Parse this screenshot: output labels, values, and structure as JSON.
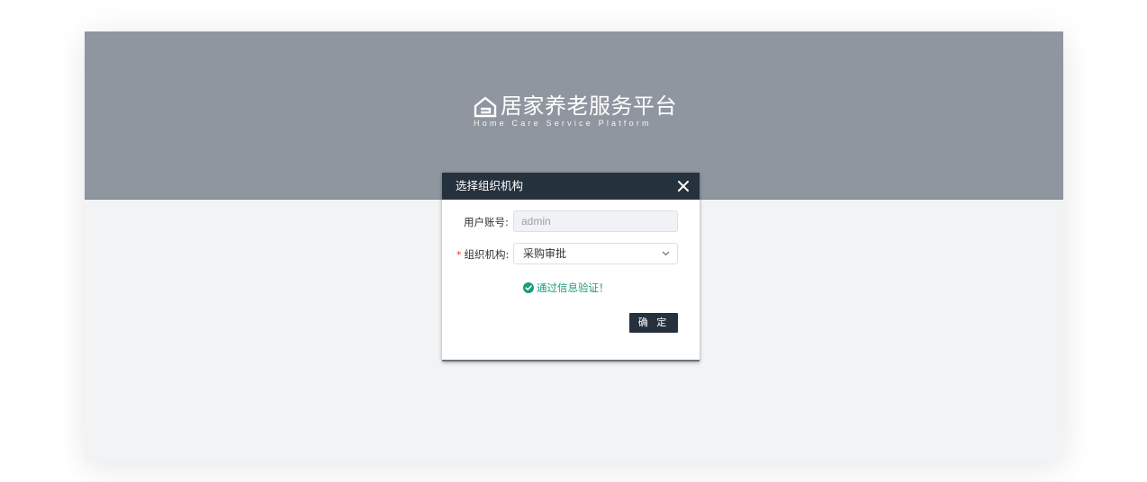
{
  "banner": {
    "logo_title": "居家养老服务平台",
    "logo_subtitle": "Home Care Service Platform",
    "logo_icon": "house-g-icon"
  },
  "dialog": {
    "title": "选择组织机构",
    "close_icon": "close-icon",
    "account_label": "用户账号:",
    "account_placeholder": "admin",
    "org_required_mark": "*",
    "org_label": "组织机构:",
    "org_value": "采购审批",
    "verify_message": "通过信息验证！",
    "confirm_label": "确 定"
  },
  "colors": {
    "banner_bg": "#8f969f",
    "dialog_header_bg": "#26313e",
    "success": "#1a9b7d",
    "required": "#e53935",
    "page_bg": "#f2f3f5"
  }
}
